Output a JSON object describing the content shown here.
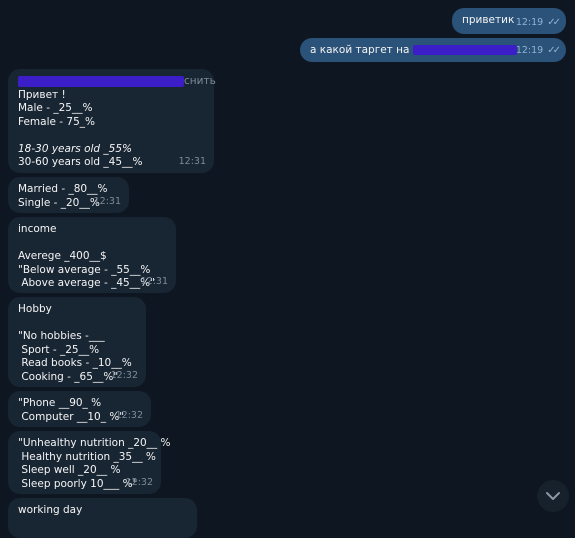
{
  "outgoing": [
    {
      "text": "приветик",
      "time": "12:19"
    },
    {
      "text": "а какой таргет на ",
      "time": "12:19"
    }
  ],
  "incoming": [
    {
      "header_suffix": "снить",
      "lines": [
        "Привет !",
        "Male - _25__%",
        "Female - 75_%",
        "",
        "18-30 years old _55%",
        "30-60 years old _45__%"
      ],
      "time": "12:31"
    },
    {
      "lines": [
        "Married - _80__%",
        "Single - _20__%"
      ],
      "time": "12:31"
    },
    {
      "lines": [
        "income",
        "",
        "Averege _400__$",
        "\"Below average - _55__%",
        " Above average - _45__%\""
      ],
      "time": "12:31"
    },
    {
      "lines": [
        "Hobby",
        "",
        "\"No hobbies -___",
        " Sport - _25__%",
        " Read books - _10__%",
        " Cooking - _65__%\""
      ],
      "time": "12:32"
    },
    {
      "lines": [
        "\"Phone __90_ %",
        " Computer __10_ %\""
      ],
      "time": "12:32"
    },
    {
      "lines": [
        "\"Unhealthy nutrition _20__ %",
        " Healthy nutrition _35__ %",
        " Sleep well _20__ %",
        " Sleep poorly 10___ %\""
      ],
      "time": "12:32"
    },
    {
      "lines": [
        "working day"
      ]
    }
  ],
  "colors": {
    "background": "#0e1621",
    "outgoing": "#2b5278",
    "incoming": "#182533",
    "redaction": "#3b1ec8"
  },
  "icons": {
    "read_receipt": "double-check-icon",
    "scroll_down": "chevron-down-icon"
  }
}
